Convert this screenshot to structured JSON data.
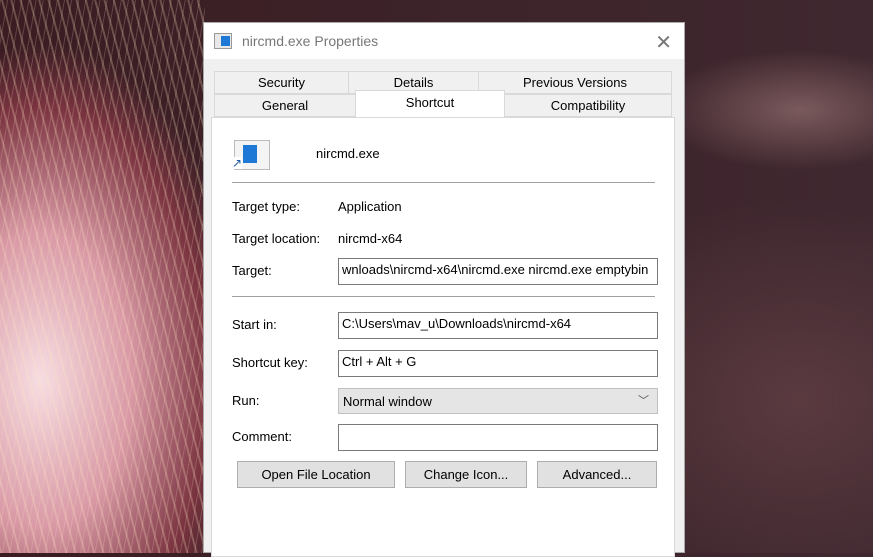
{
  "window": {
    "title": "nircmd.exe Properties"
  },
  "tabs": {
    "row1": [
      "Security",
      "Details",
      "Previous Versions"
    ],
    "row2": [
      "General",
      "Shortcut",
      "Compatibility"
    ],
    "selected": "Shortcut"
  },
  "shortcut": {
    "file_name": "nircmd.exe",
    "target_type_label": "Target type:",
    "target_type": "Application",
    "target_location_label": "Target location:",
    "target_location": "nircmd-x64",
    "target_label": "Target:",
    "target": "wnloads\\nircmd-x64\\nircmd.exe nircmd.exe emptybin",
    "start_in_label": "Start in:",
    "start_in": "C:\\Users\\mav_u\\Downloads\\nircmd-x64",
    "shortcut_key_label": "Shortcut key:",
    "shortcut_key": "Ctrl + Alt + G",
    "run_label": "Run:",
    "run": "Normal window",
    "comment_label": "Comment:",
    "comment": "",
    "buttons": {
      "open_location": "Open File Location",
      "change_icon": "Change Icon...",
      "advanced": "Advanced..."
    }
  }
}
